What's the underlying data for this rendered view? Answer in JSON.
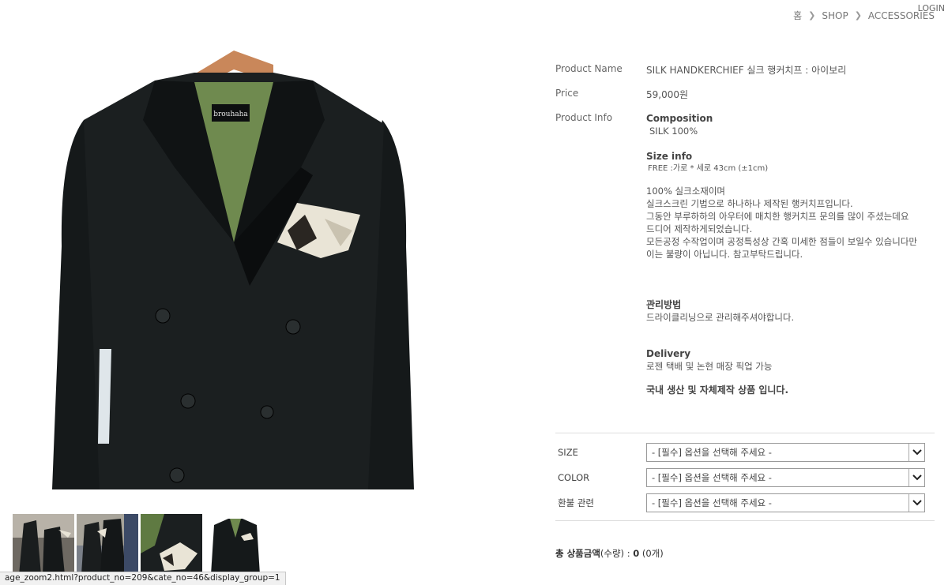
{
  "header": {
    "login_label": "LOGIN",
    "breadcrumb": [
      "홈",
      "SHOP",
      "ACCESSORIES"
    ]
  },
  "product": {
    "name_label": "Product Name",
    "name": "SILK HANDKERCHIEF 실크 행커치프 : 아이보리",
    "price_label": "Price",
    "price": "59,000원",
    "info_label": "Product Info",
    "composition_head": "Composition",
    "composition": "SILK 100%",
    "size_head": "Size info",
    "size": "FREE :가로 * 세로 43cm (±1cm)",
    "description": [
      "100% 실크소재이며",
      "실크스크린 기법으로 하나하나 제작된 행커치프입니다.",
      "그동안 부루하하의 아우터에 매치한 행커치프 문의를 많이 주셨는데요",
      "드디어 제작하게되었습니다.",
      "모든공정 수작업이며 공정특성상 간혹 미세한 점들이 보일수 있습니다만 이는 불량이 아닙니다. 참고부탁드립니다."
    ],
    "care_head": "관리방법",
    "care": "드라이클리닝으로 관리해주셔야합니다.",
    "delivery_head": "Delivery",
    "delivery": "로젠 택배 및 논현 매장 픽업 가능",
    "made_in": "국내 생산 및 자체제작 상품 입니다.",
    "brand_tag": "brouhaha"
  },
  "options": [
    {
      "label": "SIZE",
      "selected": "- [필수] 옵션을 선택해 주세요 -"
    },
    {
      "label": "COLOR",
      "selected": "- [필수] 옵션을 선택해 주세요 -"
    },
    {
      "label": "환불 관련",
      "selected": "- [필수] 옵션을 선택해 주세요 -"
    }
  ],
  "total": {
    "label": "총 상품금액",
    "qty_label": "(수량)",
    "sep": " : ",
    "amount": "0",
    "count": "(0개)"
  },
  "status_url": "age_zoom2.html?product_no=209&cate_no=46&display_group=1",
  "colors": {
    "jacket": "#15191a",
    "lining": "#6f8a4f",
    "hanger": "#c9875a"
  }
}
